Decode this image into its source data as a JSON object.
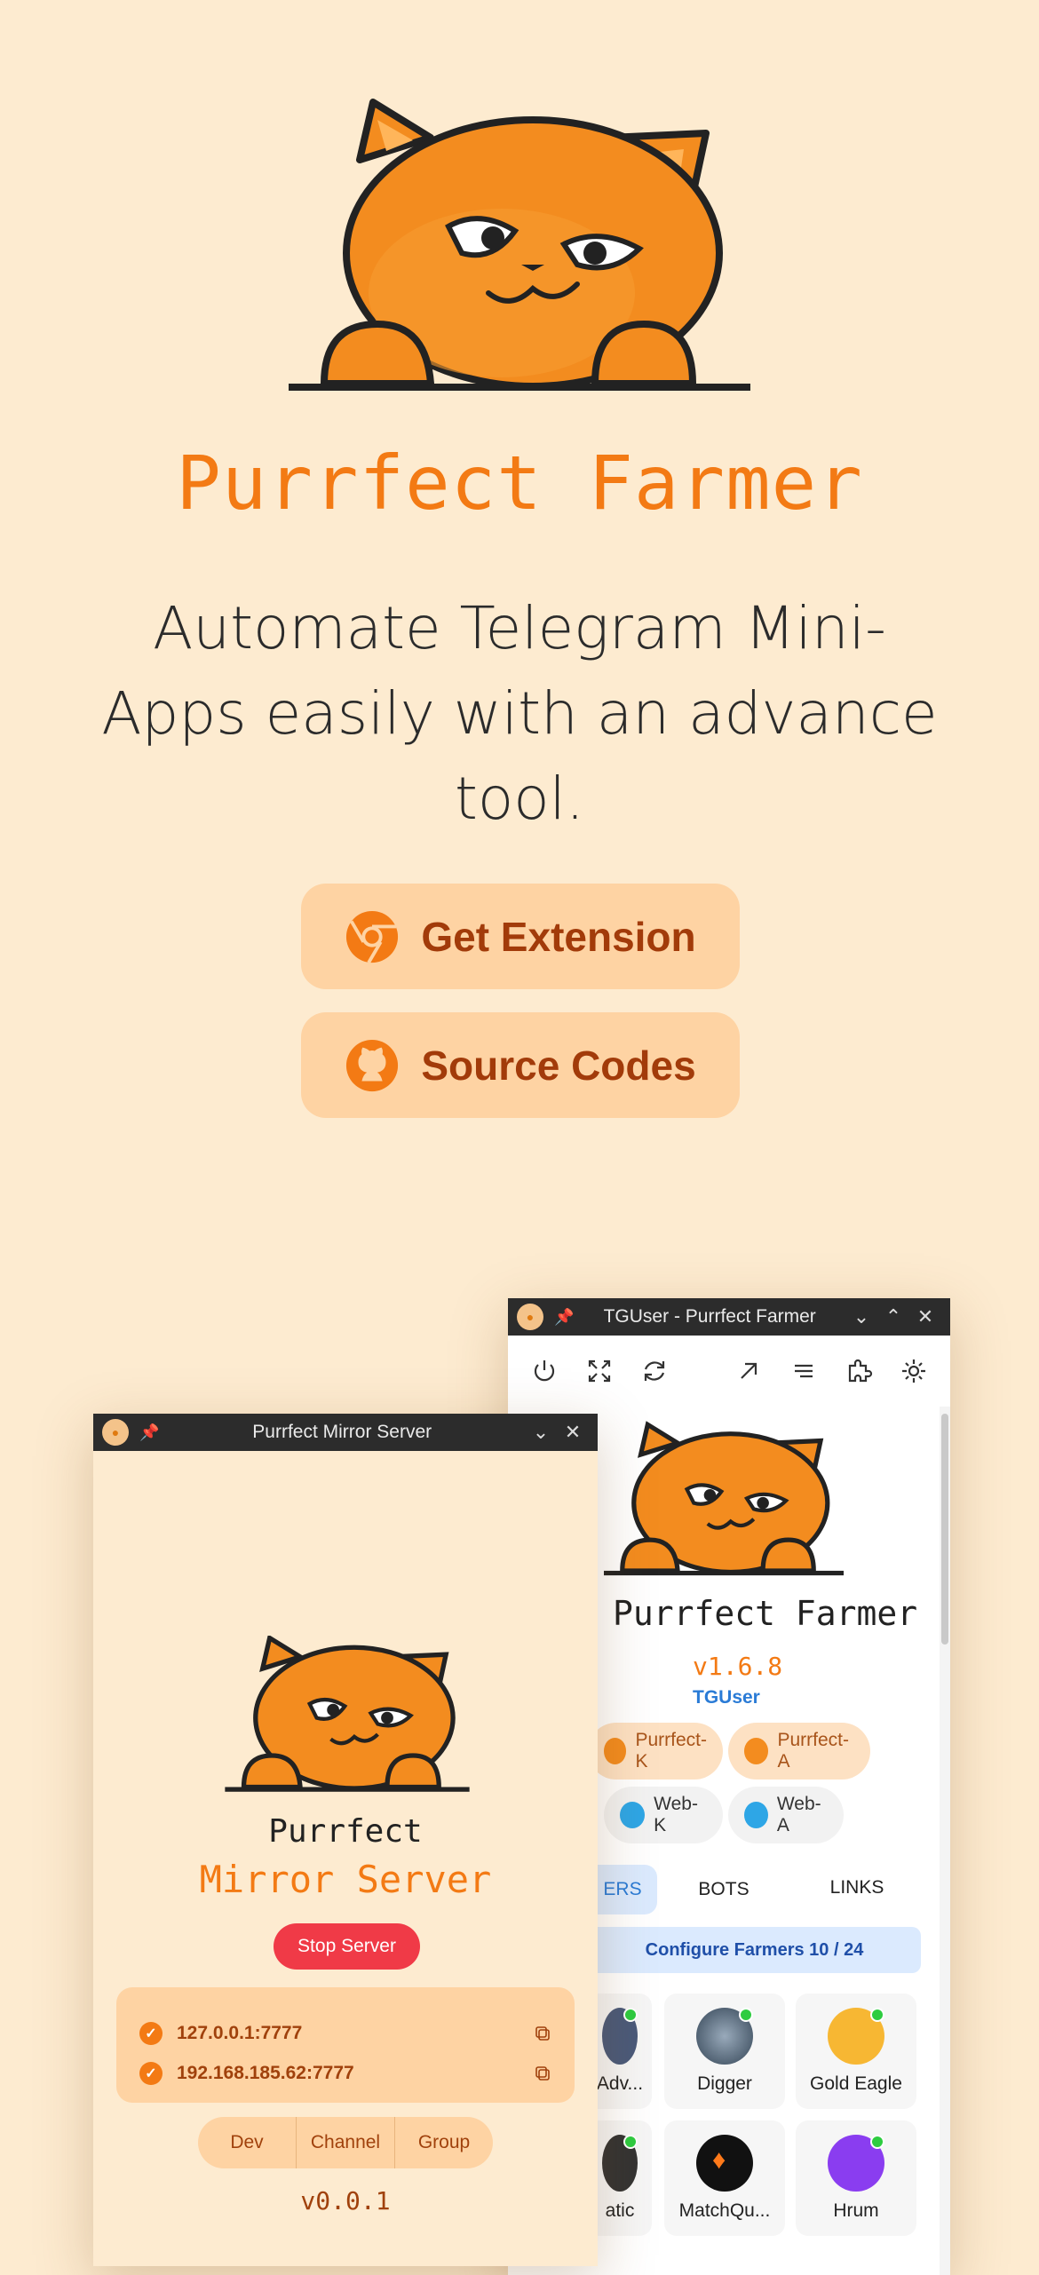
{
  "hero": {
    "title": "Purrfect Farmer",
    "tagline": "Automate Telegram Mini-Apps easily with an advance tool.",
    "buttons": [
      {
        "label": "Get Extension",
        "icon": "chrome-icon"
      },
      {
        "label": "Source Codes",
        "icon": "github-icon"
      }
    ]
  },
  "colors": {
    "background": "#fdebd0",
    "accent": "#f37a14",
    "button_bg": "#fed3a3",
    "button_text": "#a23b0a",
    "stop_red": "#f03a47",
    "link_blue": "#2a7bd6"
  },
  "tg_window": {
    "title": "TGUser - Purrfect Farmer",
    "toolbar_icons": [
      "power-icon",
      "fullscreen-icon",
      "refresh-icon",
      "open-external-icon",
      "menu-icon",
      "extension-icon",
      "settings-icon"
    ],
    "app_name": "Purrfect Farmer",
    "version": "v1.6.8",
    "user": "TGUser",
    "clients": [
      "Purrfect-K",
      "Purrfect-A",
      "Web-K",
      "Web-A"
    ],
    "tabs": [
      "ERS",
      "BOTS",
      "LINKS"
    ],
    "configure_label": "Configure Farmers 10 / 24",
    "farmers": [
      "Adv...",
      "Digger",
      "Gold Eagle",
      "atic",
      "MatchQu...",
      "Hrum"
    ]
  },
  "mirror_window": {
    "title": "Purrfect Mirror Server",
    "heading_line1": "Purrfect",
    "heading_line2": "Mirror Server",
    "stop_button": "Stop Server",
    "addresses": [
      "127.0.0.1:7777",
      "192.168.185.62:7777"
    ],
    "links": [
      "Dev",
      "Channel",
      "Group"
    ],
    "version": "v0.0.1"
  }
}
